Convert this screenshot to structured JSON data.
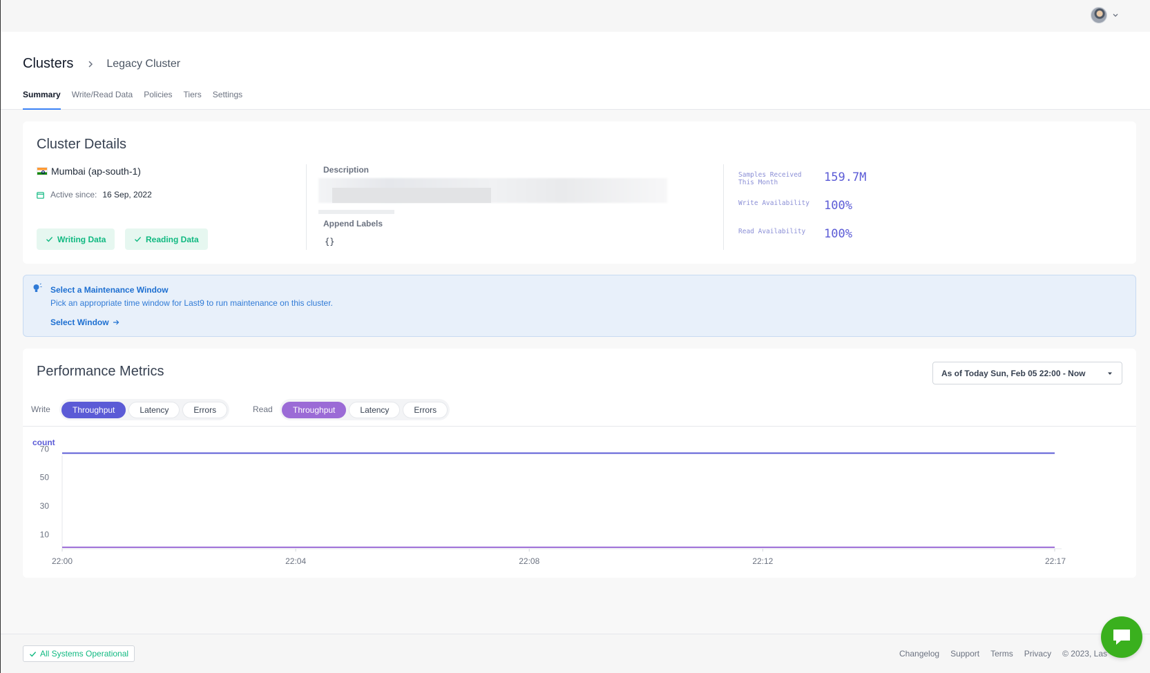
{
  "breadcrumb": {
    "root": "Clusters",
    "current": "Legacy Cluster"
  },
  "tabs": [
    {
      "label": "Summary",
      "active": true
    },
    {
      "label": "Write/Read Data"
    },
    {
      "label": "Policies"
    },
    {
      "label": "Tiers"
    },
    {
      "label": "Settings"
    }
  ],
  "details": {
    "title": "Cluster Details",
    "region": "Mumbai (ap-south-1)",
    "active_since_label": "Active since:",
    "active_since_date": "16 Sep, 2022",
    "writing_label": "Writing Data",
    "reading_label": "Reading Data",
    "description_label": "Description",
    "append_labels_label": "Append Labels",
    "append_labels_value": "{}",
    "stats": [
      {
        "label": "Samples Received This Month",
        "value": "159.7M"
      },
      {
        "label": "Write Availability",
        "value": "100%"
      },
      {
        "label": "Read Availability",
        "value": "100%"
      }
    ]
  },
  "banner": {
    "title": "Select a Maintenance Window",
    "text": "Pick an appropriate time window for Last9 to run maintenance on this cluster.",
    "link": "Select Window"
  },
  "performance": {
    "title": "Performance Metrics",
    "range": "As of Today Sun, Feb 05 22:00 - Now",
    "write_label": "Write",
    "read_label": "Read",
    "write_buttons": [
      "Throughput",
      "Latency",
      "Errors"
    ],
    "read_buttons": [
      "Throughput",
      "Latency",
      "Errors"
    ]
  },
  "chart_data": {
    "type": "line",
    "ylabel": "count",
    "yticks": [
      70,
      50,
      30,
      10
    ],
    "ylim": [
      0,
      75
    ],
    "xticks": [
      "22:00",
      "22:04",
      "22:08",
      "22:12",
      "22:17"
    ],
    "series": [
      {
        "color": "#5b5bd6",
        "x": [
          "22:00",
          "22:17"
        ],
        "values": [
          67,
          67
        ]
      },
      {
        "color": "#9b6bd6",
        "x": [
          "22:00",
          "22:17"
        ],
        "values": [
          1,
          1
        ]
      }
    ]
  },
  "footer": {
    "status": "All Systems Operational",
    "links": [
      "Changelog",
      "Support",
      "Terms",
      "Privacy",
      "© 2023, Las"
    ]
  },
  "colors": {
    "accent": "#5b5bd6",
    "read_accent": "#9b6bd6",
    "success": "#10b981",
    "info": "#1d6fd1",
    "chat": "#3ab01e"
  }
}
